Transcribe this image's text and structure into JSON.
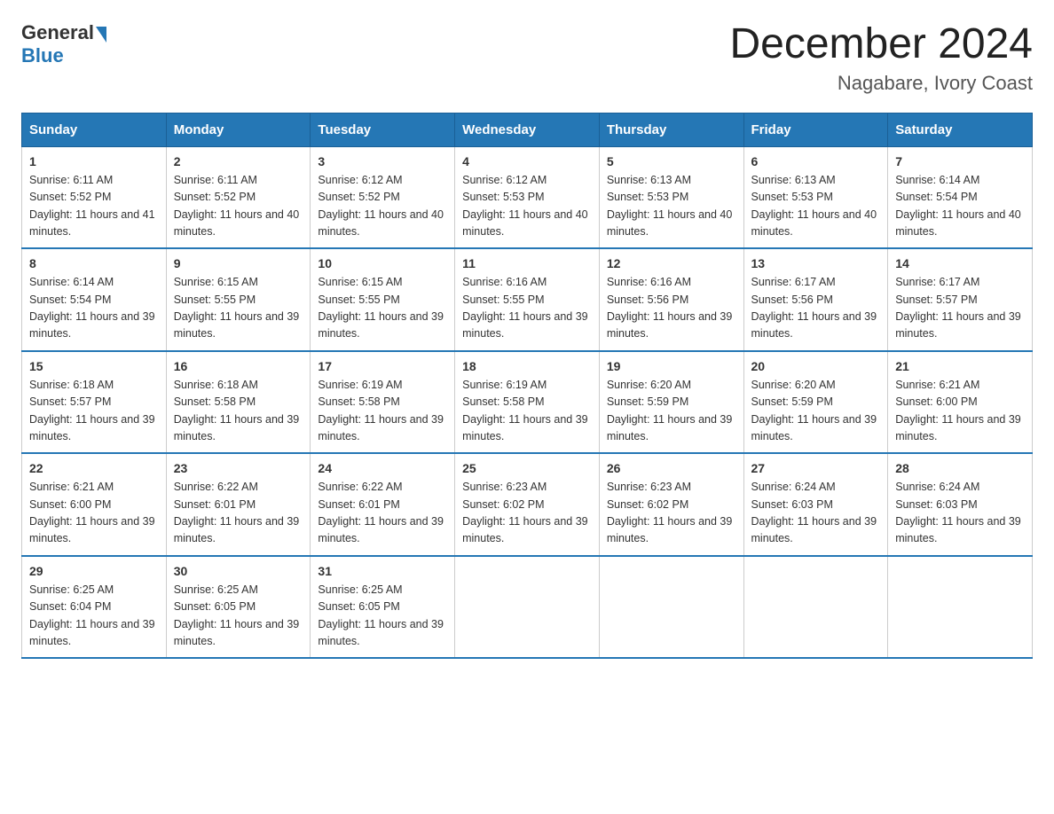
{
  "logo": {
    "general": "General",
    "blue": "Blue"
  },
  "title": "December 2024",
  "subtitle": "Nagabare, Ivory Coast",
  "days_of_week": [
    "Sunday",
    "Monday",
    "Tuesday",
    "Wednesday",
    "Thursday",
    "Friday",
    "Saturday"
  ],
  "weeks": [
    [
      {
        "day": "1",
        "sunrise": "6:11 AM",
        "sunset": "5:52 PM",
        "daylight": "11 hours and 41 minutes."
      },
      {
        "day": "2",
        "sunrise": "6:11 AM",
        "sunset": "5:52 PM",
        "daylight": "11 hours and 40 minutes."
      },
      {
        "day": "3",
        "sunrise": "6:12 AM",
        "sunset": "5:52 PM",
        "daylight": "11 hours and 40 minutes."
      },
      {
        "day": "4",
        "sunrise": "6:12 AM",
        "sunset": "5:53 PM",
        "daylight": "11 hours and 40 minutes."
      },
      {
        "day": "5",
        "sunrise": "6:13 AM",
        "sunset": "5:53 PM",
        "daylight": "11 hours and 40 minutes."
      },
      {
        "day": "6",
        "sunrise": "6:13 AM",
        "sunset": "5:53 PM",
        "daylight": "11 hours and 40 minutes."
      },
      {
        "day": "7",
        "sunrise": "6:14 AM",
        "sunset": "5:54 PM",
        "daylight": "11 hours and 40 minutes."
      }
    ],
    [
      {
        "day": "8",
        "sunrise": "6:14 AM",
        "sunset": "5:54 PM",
        "daylight": "11 hours and 39 minutes."
      },
      {
        "day": "9",
        "sunrise": "6:15 AM",
        "sunset": "5:55 PM",
        "daylight": "11 hours and 39 minutes."
      },
      {
        "day": "10",
        "sunrise": "6:15 AM",
        "sunset": "5:55 PM",
        "daylight": "11 hours and 39 minutes."
      },
      {
        "day": "11",
        "sunrise": "6:16 AM",
        "sunset": "5:55 PM",
        "daylight": "11 hours and 39 minutes."
      },
      {
        "day": "12",
        "sunrise": "6:16 AM",
        "sunset": "5:56 PM",
        "daylight": "11 hours and 39 minutes."
      },
      {
        "day": "13",
        "sunrise": "6:17 AM",
        "sunset": "5:56 PM",
        "daylight": "11 hours and 39 minutes."
      },
      {
        "day": "14",
        "sunrise": "6:17 AM",
        "sunset": "5:57 PM",
        "daylight": "11 hours and 39 minutes."
      }
    ],
    [
      {
        "day": "15",
        "sunrise": "6:18 AM",
        "sunset": "5:57 PM",
        "daylight": "11 hours and 39 minutes."
      },
      {
        "day": "16",
        "sunrise": "6:18 AM",
        "sunset": "5:58 PM",
        "daylight": "11 hours and 39 minutes."
      },
      {
        "day": "17",
        "sunrise": "6:19 AM",
        "sunset": "5:58 PM",
        "daylight": "11 hours and 39 minutes."
      },
      {
        "day": "18",
        "sunrise": "6:19 AM",
        "sunset": "5:58 PM",
        "daylight": "11 hours and 39 minutes."
      },
      {
        "day": "19",
        "sunrise": "6:20 AM",
        "sunset": "5:59 PM",
        "daylight": "11 hours and 39 minutes."
      },
      {
        "day": "20",
        "sunrise": "6:20 AM",
        "sunset": "5:59 PM",
        "daylight": "11 hours and 39 minutes."
      },
      {
        "day": "21",
        "sunrise": "6:21 AM",
        "sunset": "6:00 PM",
        "daylight": "11 hours and 39 minutes."
      }
    ],
    [
      {
        "day": "22",
        "sunrise": "6:21 AM",
        "sunset": "6:00 PM",
        "daylight": "11 hours and 39 minutes."
      },
      {
        "day": "23",
        "sunrise": "6:22 AM",
        "sunset": "6:01 PM",
        "daylight": "11 hours and 39 minutes."
      },
      {
        "day": "24",
        "sunrise": "6:22 AM",
        "sunset": "6:01 PM",
        "daylight": "11 hours and 39 minutes."
      },
      {
        "day": "25",
        "sunrise": "6:23 AM",
        "sunset": "6:02 PM",
        "daylight": "11 hours and 39 minutes."
      },
      {
        "day": "26",
        "sunrise": "6:23 AM",
        "sunset": "6:02 PM",
        "daylight": "11 hours and 39 minutes."
      },
      {
        "day": "27",
        "sunrise": "6:24 AM",
        "sunset": "6:03 PM",
        "daylight": "11 hours and 39 minutes."
      },
      {
        "day": "28",
        "sunrise": "6:24 AM",
        "sunset": "6:03 PM",
        "daylight": "11 hours and 39 minutes."
      }
    ],
    [
      {
        "day": "29",
        "sunrise": "6:25 AM",
        "sunset": "6:04 PM",
        "daylight": "11 hours and 39 minutes."
      },
      {
        "day": "30",
        "sunrise": "6:25 AM",
        "sunset": "6:05 PM",
        "daylight": "11 hours and 39 minutes."
      },
      {
        "day": "31",
        "sunrise": "6:25 AM",
        "sunset": "6:05 PM",
        "daylight": "11 hours and 39 minutes."
      },
      null,
      null,
      null,
      null
    ]
  ]
}
